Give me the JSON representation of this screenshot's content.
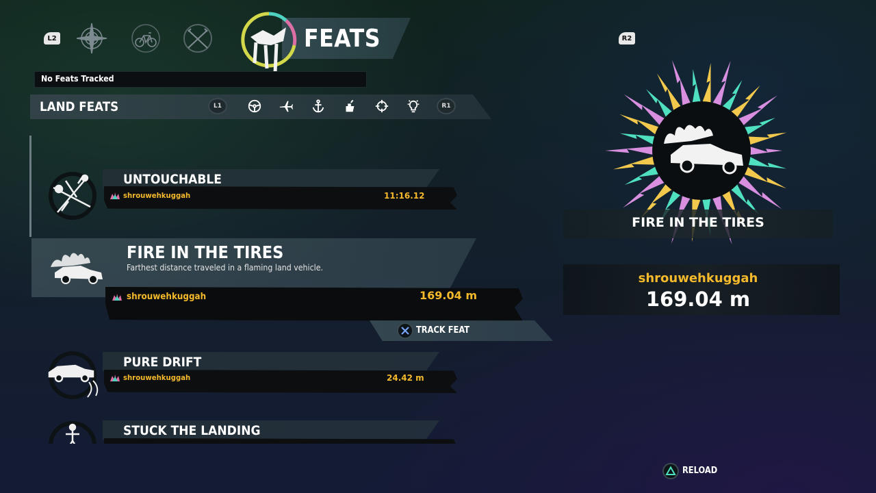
{
  "header": {
    "left_trigger": "L2",
    "right_trigger": "R2",
    "title": "FEATS",
    "nav_icons": [
      "compass-icon",
      "bicycle-icon",
      "crossed-weapons-icon"
    ]
  },
  "tracking": {
    "status": "No Feats Tracked"
  },
  "category": {
    "title": "LAND FEATS",
    "prev_button": "L1",
    "next_button": "R1",
    "icons": [
      "steering-wheel-icon",
      "airplane-icon",
      "anchor-icon",
      "hand-icon",
      "crosshair-icon",
      "lightbulb-icon"
    ]
  },
  "feats": [
    {
      "title": "UNTOUCHABLE",
      "player": "shrouwehkuggah",
      "value": "11:16.12",
      "icon": "crossed-tools-icon"
    },
    {
      "title": "FIRE IN THE TIRES",
      "description": "Farthest distance traveled in a flaming land vehicle.",
      "player": "shrouwehkuggah",
      "value": "169.04 m",
      "icon": "flaming-car-icon",
      "selected": true
    },
    {
      "title": "PURE DRIFT",
      "player": "shrouwehkuggah",
      "value": "24.42 m",
      "icon": "drifting-car-icon"
    },
    {
      "title": "STUCK THE LANDING",
      "icon": "landing-figure-icon"
    }
  ],
  "actions": {
    "track_feat": "TRACK FEAT",
    "reload": "RELOAD"
  },
  "detail": {
    "title": "FIRE IN THE TIRES",
    "player": "shrouwehkuggah",
    "value": "169.04 m"
  },
  "colors": {
    "accent_gold": "#f5b92c",
    "burst_pink": "#d88fe0",
    "burst_teal": "#4fe0c0",
    "burst_yellow": "#f2c94c"
  }
}
